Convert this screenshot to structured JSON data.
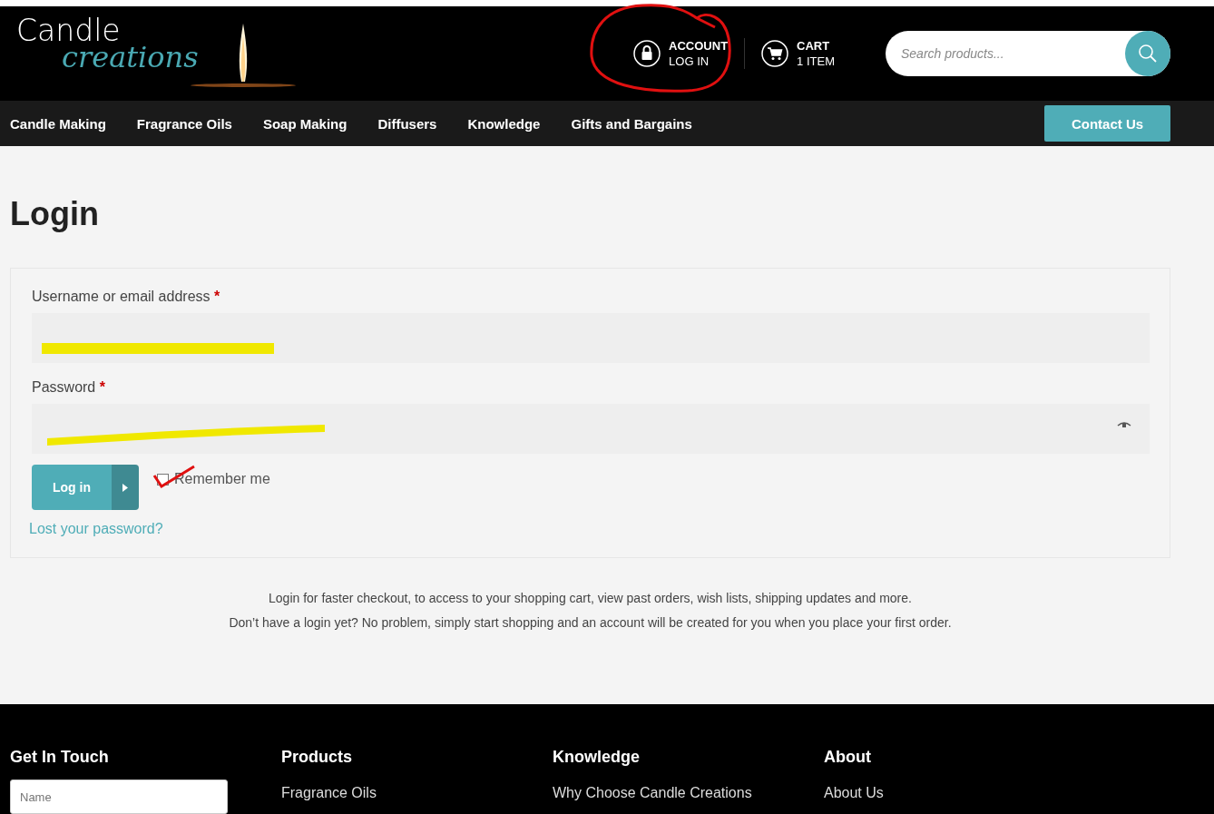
{
  "logo": {
    "word_1": "Candle",
    "word_2": "creations"
  },
  "account": {
    "title": "ACCOUNT",
    "subtitle": "LOG IN"
  },
  "cart": {
    "title": "CART",
    "subtitle": "1 ITEM"
  },
  "search": {
    "placeholder": "Search products..."
  },
  "nav": {
    "items": [
      "Candle Making",
      "Fragrance Oils",
      "Soap Making",
      "Diffusers",
      "Knowledge",
      "Gifts and Bargains"
    ],
    "contact": "Contact Us"
  },
  "page_title": "Login",
  "form": {
    "username_label": "Username or email address",
    "password_label": "Password",
    "required_mark": "*",
    "submit": "Log in",
    "remember": {
      "label": "Remember me",
      "checked": false
    },
    "lost_password": "Lost your password?"
  },
  "info": [
    "Login for faster checkout, to access to your shopping cart, view past orders, wish lists, shipping updates and more.",
    "Don’t have a login yet? No problem, simply start shopping and an account will be created for you when you place your first order."
  ],
  "footer": {
    "columns": [
      {
        "heading": "Get In Touch",
        "kind": "form",
        "placeholder": "Name"
      },
      {
        "heading": "Products",
        "kind": "links",
        "links": [
          "Fragrance Oils"
        ]
      },
      {
        "heading": "Knowledge",
        "kind": "links",
        "links": [
          "Why Choose Candle Creations"
        ]
      },
      {
        "heading": "About",
        "kind": "links",
        "links": [
          "About Us"
        ]
      }
    ]
  }
}
